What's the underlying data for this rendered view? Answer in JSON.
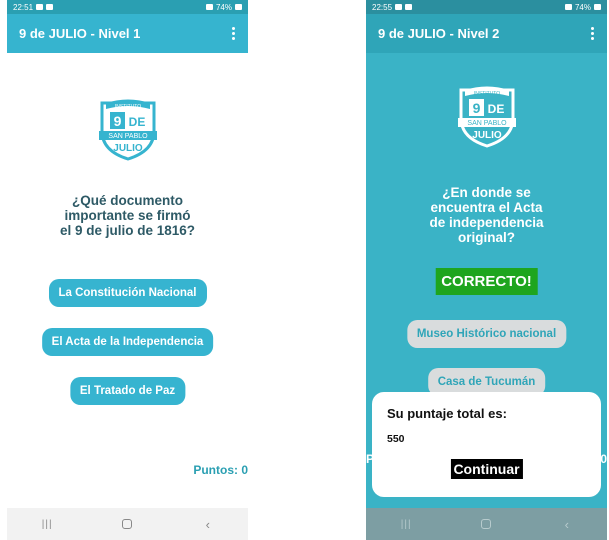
{
  "phone1": {
    "status": {
      "time": "22:51",
      "battery": "74%"
    },
    "title": "9 de JULIO - Nivel 1",
    "logo": {
      "top_text": "INSTITUTO",
      "num": "9",
      "de": "DE",
      "band": "SAN PABLO",
      "bottom": "JULIO"
    },
    "question": "¿Qué documento importante se firmó el 9 de julio de 1816?",
    "answers": [
      "La Constitución Nacional",
      "El Acta de la Independencia",
      "El Tratado de Paz"
    ],
    "score_text": "Puntos: 0"
  },
  "phone2": {
    "status": {
      "time": "22:55",
      "battery": "74%"
    },
    "title": "9 de JULIO - Nivel 2",
    "logo": {
      "top_text": "INSTITUTO",
      "num": "9",
      "de": "DE",
      "band": "SAN PABLO",
      "bottom": "JULIO"
    },
    "question": "¿En donde se encuentra el Acta de independencia original?",
    "feedback": "CORRECTO!",
    "answers": [
      "Museo Histórico nacional",
      "Casa de Tucumán"
    ],
    "peek_left": "P",
    "peek_right": "0",
    "dialog": {
      "title": "Su puntaje total es:",
      "value": "550",
      "button": "Continuar"
    }
  },
  "colors": {
    "accent": "#36b4cf",
    "correct": "#1ea51e",
    "level2_bg": "#3ab3c6"
  },
  "icons": [
    "more-vert-icon",
    "recents-icon",
    "home-icon",
    "back-icon"
  ]
}
